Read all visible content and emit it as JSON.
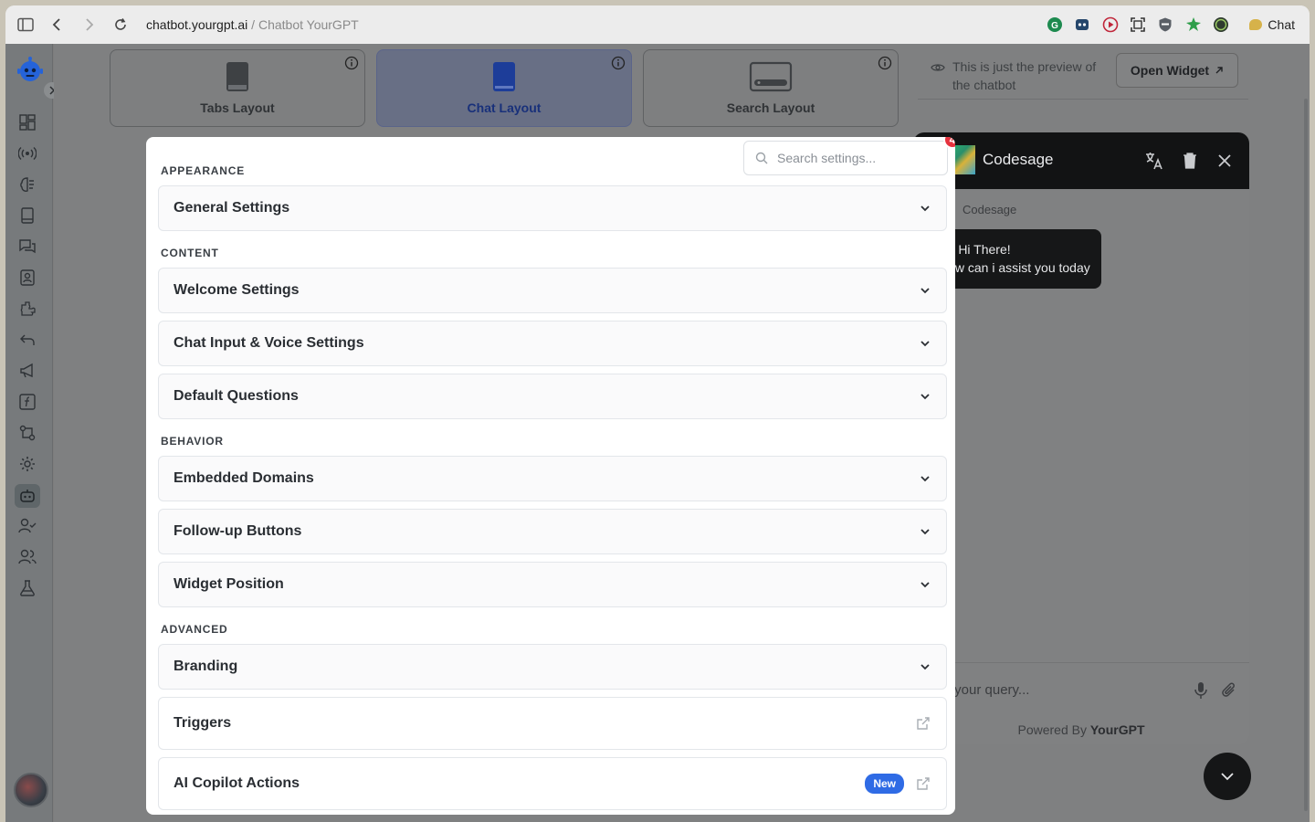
{
  "browser": {
    "url_domain": "chatbot.yourgpt.ai",
    "url_separator": " / ",
    "url_page": "Chatbot YourGPT",
    "chat_button": "Chat"
  },
  "layouts": [
    {
      "label": "Tabs Layout",
      "active": false
    },
    {
      "label": "Chat Layout",
      "active": true
    },
    {
      "label": "Search Layout",
      "active": false
    }
  ],
  "preview": {
    "note": "This is just the preview of the chatbot",
    "open_widget": "Open Widget"
  },
  "settings": {
    "search_placeholder": "Search settings...",
    "badge_count": "4",
    "sections": {
      "appearance": "APPEARANCE",
      "content": "CONTENT",
      "behavior": "BEHAVIOR",
      "advanced": "ADVANCED"
    },
    "items": {
      "general": "General Settings",
      "welcome": "Welcome Settings",
      "chat_input": "Chat Input & Voice Settings",
      "default_questions": "Default Questions",
      "embedded_domains": "Embedded Domains",
      "followup": "Follow-up Buttons",
      "widget_position": "Widget Position",
      "branding": "Branding",
      "triggers": "Triggers",
      "copilot": "AI Copilot Actions"
    },
    "new_badge": "New"
  },
  "widget": {
    "bot_name": "Codesage",
    "message_sender": "Codesage",
    "message_line1": "👋 Hi There!",
    "message_line2": "How can i assist you today",
    "input_placeholder": "Ask your query...",
    "powered_prefix": "Powered By ",
    "powered_brand": "YourGPT"
  },
  "colors": {
    "accent": "#2f6be5",
    "badge_red": "#e5323e",
    "widget_header": "#121314"
  }
}
